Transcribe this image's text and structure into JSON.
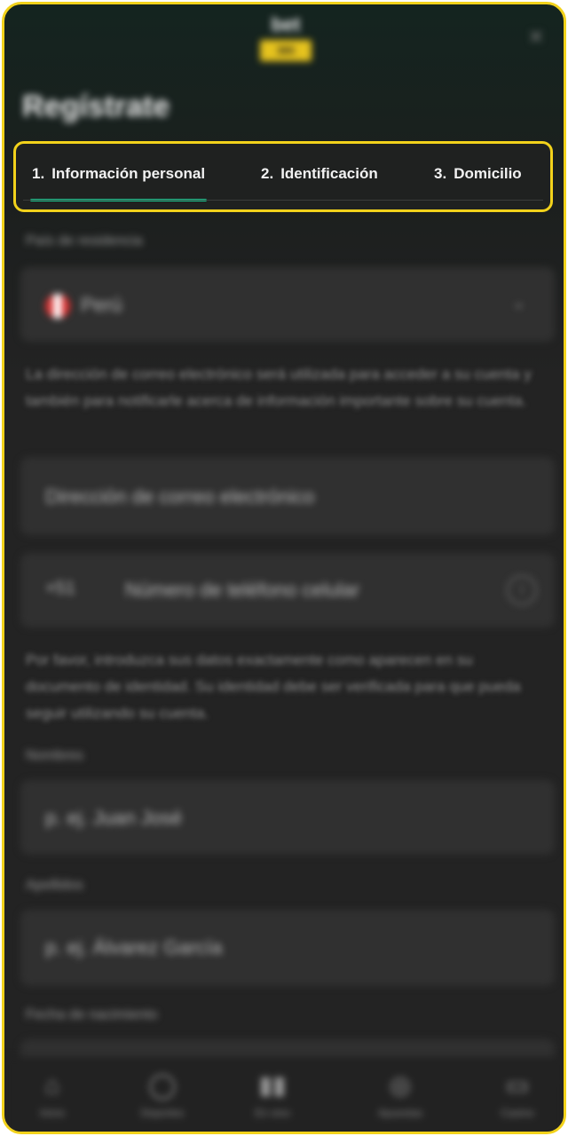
{
  "header": {
    "logo_top": "bet",
    "logo_bottom": "365",
    "close_icon": "close-icon"
  },
  "title": "Regístrate",
  "tabs": [
    {
      "num": "1.",
      "label": "Información personal",
      "active": true
    },
    {
      "num": "2.",
      "label": "Identificación",
      "active": false
    },
    {
      "num": "3.",
      "label": "Domicilio",
      "active": false
    }
  ],
  "form": {
    "country_label": "País de residencia",
    "country_value": "Perú",
    "email_note": "La dirección de correo electrónico será utilizada para acceder a su cuenta y también para notificarle acerca de información importante sobre su cuenta.",
    "email_placeholder": "Dirección de correo electrónico",
    "phone_prefix": "+51",
    "phone_placeholder": "Número de teléfono celular",
    "names_note": "Por favor, introduzca sus datos exactamente como aparecen en su documento de identidad. Su identidad debe ser verificada para que pueda seguir utilizando su cuenta.",
    "name_label": "Nombres",
    "name_placeholder": "p. ej. Juan José",
    "surname_label": "Apellidos",
    "surname_placeholder": "p. ej. Álvarez García",
    "dob_label": "Fecha de nacimiento"
  },
  "bottom_nav": [
    {
      "icon": "home-icon",
      "label": "Inicio"
    },
    {
      "icon": "sports-icon",
      "label": "Deportes"
    },
    {
      "icon": "live-icon",
      "label": "En vivo"
    },
    {
      "icon": "bets-icon",
      "label": "Apuestas"
    },
    {
      "icon": "casino-icon",
      "label": "Casino"
    }
  ]
}
